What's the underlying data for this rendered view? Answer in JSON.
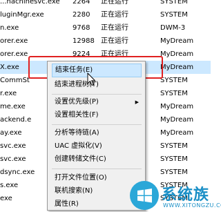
{
  "rows": [
    {
      "name": "...nachinesvc.exe",
      "pid": "2264",
      "status": "正在运行",
      "user": "SYSTEM"
    },
    {
      "name": "luginMgr.exe",
      "pid": "2280",
      "status": "正在运行",
      "user": "SYSTEM"
    },
    {
      "name": "n.exe",
      "pid": "9768",
      "status": "正在运行",
      "user": "DWM-3"
    },
    {
      "name": "orer.exe",
      "pid": "12988",
      "status": "正在运行",
      "user": "MyDream"
    },
    {
      "name": "orer.exe",
      "pid": "9224",
      "status": "正在运行",
      "user": "MyDream"
    },
    {
      "name": "X.exe",
      "pid": "",
      "status": "",
      "user": "MyDream"
    },
    {
      "name": "CommSt",
      "pid": "",
      "status": "",
      "user": "SYSTEM"
    },
    {
      "name": "r.exe",
      "pid": "",
      "status": "",
      "user": "SYSTEM"
    },
    {
      "name": "me.exe",
      "pid": "",
      "status": "",
      "user": "MyDream"
    },
    {
      "name": "ackend.e",
      "pid": "",
      "status": "",
      "user": "MyDream"
    },
    {
      "name": "ay.exe",
      "pid": "",
      "status": "",
      "user": "MyDream"
    },
    {
      "name": "svc.exe",
      "pid": "",
      "status": "",
      "user": "SYSTEM"
    },
    {
      "name": "svc.exe",
      "pid": "",
      "status": "",
      "user": "SYSTEM"
    },
    {
      "name": "dsync.exe",
      "pid": "",
      "status": "",
      "user": "SYSTEM"
    },
    {
      "name": "s.exe",
      "pid": "",
      "status": "",
      "user": "SYSTEM"
    },
    {
      "name": "exe",
      "pid": "",
      "status": "",
      "user": "SYSTEM"
    }
  ],
  "menu": {
    "items": [
      {
        "label": "结束任务(E)",
        "active": true
      },
      {
        "label": "结束进程树(T)"
      },
      {
        "label": "设置优先级(P)",
        "submenu": true
      },
      {
        "label": "设置相关性(F)"
      },
      {
        "label": "分析等待链(A)"
      },
      {
        "label": "UAC 虚拟化(V)"
      },
      {
        "label": "创建转储文件(C)"
      },
      {
        "label": "打开文件位置(O)"
      },
      {
        "label": "联机搜索(N)"
      },
      {
        "label": "属性(R)"
      }
    ]
  },
  "watermark": {
    "text": "系统族",
    "url": "WWW.XITONGZU.COM"
  },
  "colors": {
    "selection": "#cce8ff",
    "highlight": "#e02020",
    "brand": "#1a8fc6"
  }
}
